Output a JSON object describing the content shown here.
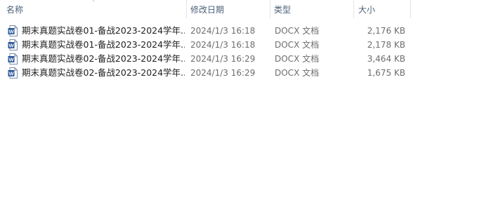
{
  "columns": {
    "name": "名称",
    "modified": "修改日期",
    "type": "类型",
    "size": "大小"
  },
  "sort_indicator": "˄",
  "files": [
    {
      "name": "期末真题实战卷01-备战2023-2024学年...",
      "modified": "2024/1/3 16:18",
      "type": "DOCX 文档",
      "size": "2,176 KB",
      "icon": "word-doc-icon"
    },
    {
      "name": "期末真题实战卷01-备战2023-2024学年...",
      "modified": "2024/1/3 16:18",
      "type": "DOCX 文档",
      "size": "2,178 KB",
      "icon": "word-doc-icon"
    },
    {
      "name": "期末真题实战卷02-备战2023-2024学年...",
      "modified": "2024/1/3 16:29",
      "type": "DOCX 文档",
      "size": "3,464 KB",
      "icon": "word-doc-icon"
    },
    {
      "name": "期末真题实战卷02-备战2023-2024学年...",
      "modified": "2024/1/3 16:29",
      "type": "DOCX 文档",
      "size": "1,675 KB",
      "icon": "word-doc-icon"
    }
  ],
  "colors": {
    "header_text": "#4c607a",
    "detail_text": "#6d6d6d",
    "word_blue": "#2b579a"
  }
}
